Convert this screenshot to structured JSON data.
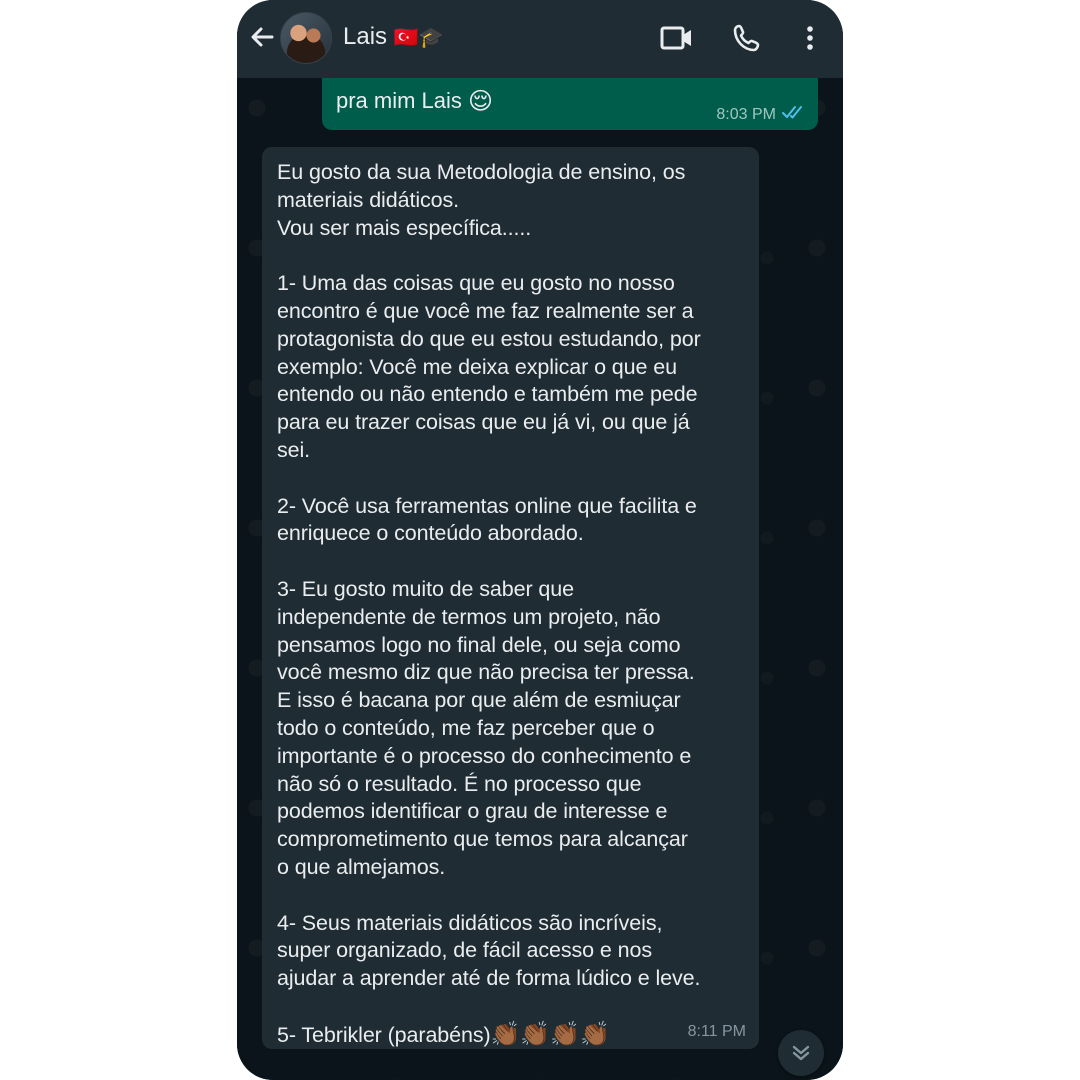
{
  "header": {
    "contact_name": "Lais",
    "contact_emoji": "🇹🇷🎓",
    "back_icon": "arrow-left-icon",
    "video_icon": "video-call-icon",
    "call_icon": "phone-icon",
    "menu_icon": "more-vertical-icon"
  },
  "messages": {
    "outgoing": {
      "text": "pra mim Lais",
      "emoji": "😌",
      "time": "8:03 PM",
      "status_icon": "double-check-read-icon"
    },
    "incoming": {
      "text": "Eu gosto da sua Metodologia de ensino, os\nmateriais didáticos.\nVou ser mais específica.....\n\n1- Uma das coisas que eu gosto no nosso\nencontro é que você me faz realmente ser a\nprotagonista do que eu estou estudando, por\nexemplo: Você me deixa explicar o que eu\nentendo ou não entendo e também me pede\npara eu trazer coisas que eu já vi, ou que já\nsei.\n\n2- Você usa ferramentas online que facilita e\nenriquece o conteúdo abordado.\n\n3- Eu gosto muito de saber que\nindependente de termos um projeto, não\npensamos logo no final dele, ou seja como\nvocê mesmo diz que não precisa ter pressa.\nE isso é bacana por que além de esmiuçar\ntodo o conteúdo, me faz perceber que o\nimportante é o processo do conhecimento e\nnão só o resultado. É no processo que\npodemos identificar o grau de interesse e\ncomprometimento que temos para alcançar\no que almejamos.\n\n4- Seus materiais didáticos são incríveis,\nsuper organizado, de fácil acesso e nos\najudar a aprender até de forma lúdico e leve.\n\n5- Tebrikler (parabéns)",
      "emoji": "👏🏾👏🏾👏🏾👏🏾",
      "time": "8:11 PM"
    }
  },
  "scroll_icon": "double-chevron-down-icon",
  "colors": {
    "header_bg": "#1f2c34",
    "chat_bg": "#0b141a",
    "outgoing_bubble": "#005c4b",
    "incoming_bubble": "#202c33",
    "read_tick": "#53bdeb"
  }
}
